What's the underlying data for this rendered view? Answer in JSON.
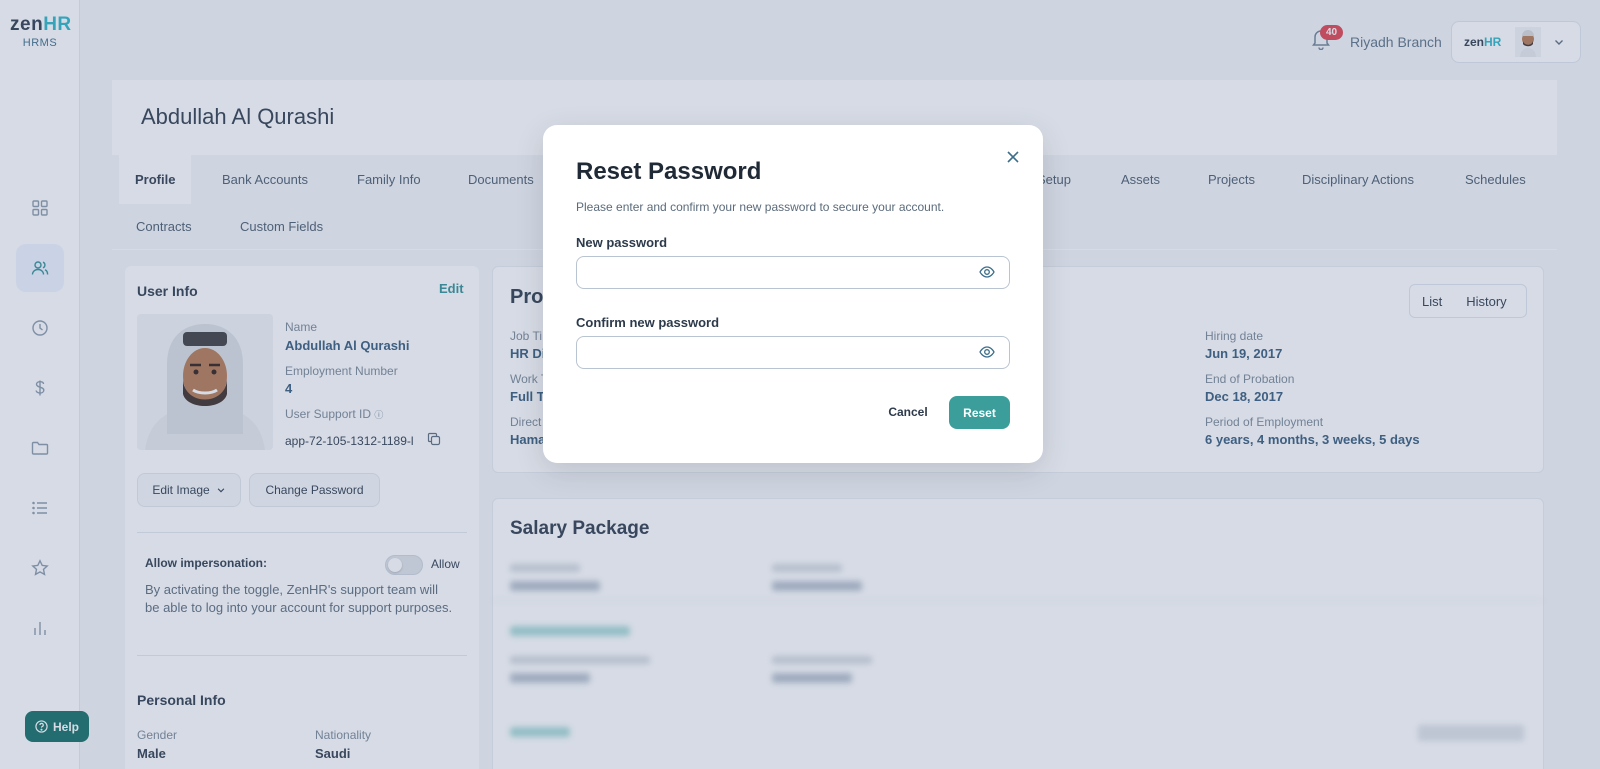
{
  "app": {
    "logo_main": "zen",
    "logo_accent": "HR",
    "logo_sub": "HRMS",
    "help_label": "Help"
  },
  "sidebar": {
    "items": [
      {
        "icon": "dashboard-icon"
      },
      {
        "icon": "users-icon"
      },
      {
        "icon": "clock-icon"
      },
      {
        "icon": "dollar-icon"
      },
      {
        "icon": "folder-icon"
      },
      {
        "icon": "list-icon"
      },
      {
        "icon": "star-icon"
      },
      {
        "icon": "bar-chart-icon"
      }
    ],
    "active_index": 1
  },
  "header": {
    "notification_count": "40",
    "branch": "Riyadh Branch",
    "company_logo_main": "zen",
    "company_logo_accent": "HR"
  },
  "page": {
    "title": "Abdullah Al Qurashi",
    "tabs_row1": [
      "Profile",
      "Bank Accounts",
      "Family Info",
      "Documents",
      "Setup",
      "Assets",
      "Projects",
      "Disciplinary Actions",
      "Schedules"
    ],
    "tabs_row2": [
      "Contracts",
      "Custom Fields"
    ],
    "active_tab": "Profile"
  },
  "user_info": {
    "title": "User Info",
    "edit_label": "Edit",
    "name_label": "Name",
    "name_value": "Abdullah Al Qurashi",
    "emp_number_label": "Employment Number",
    "emp_number_value": "4",
    "support_id_label": "User Support ID",
    "support_id_value": "app-72-105-1312-1189-l",
    "edit_image_label": "Edit Image",
    "change_password_label": "Change Password",
    "impersonation_label": "Allow impersonation:",
    "impersonation_toggle_label": "Allow",
    "impersonation_desc": "By activating the toggle, ZenHR's support team will be able to log into your account for support purposes.",
    "personal_info_title": "Personal Info",
    "gender_label": "Gender",
    "gender_value": "Male",
    "nationality_label": "Nationality",
    "nationality_value": "Saudi"
  },
  "profile_card": {
    "title": "Prof",
    "view_list": "List",
    "view_history": "History",
    "job_title_label": "Job Ti",
    "job_title_value": "HR Di",
    "work_type_label": "Work T",
    "work_type_value": "Full Ti",
    "direct_label": "Direct",
    "direct_value": "Hama",
    "hiring_date_label": "Hiring date",
    "hiring_date_value": "Jun 19, 2017",
    "end_probation_label": "End of Probation",
    "end_probation_value": "Dec 18, 2017",
    "period_label": "Period of Employment",
    "period_value": "6 years, 4 months, 3 weeks, 5 days"
  },
  "salary": {
    "title": "Salary Package"
  },
  "modal": {
    "title": "Reset Password",
    "description": "Please enter and confirm your new password to secure your account.",
    "new_password_label": "New password",
    "new_password_value": "",
    "confirm_password_label": "Confirm new password",
    "confirm_password_value": "",
    "cancel_label": "Cancel",
    "reset_label": "Reset"
  },
  "colors": {
    "accent": "#29b6c6",
    "primary_button": "#3b9e9b",
    "help_button": "#106b62",
    "badge": "#e0424d"
  }
}
